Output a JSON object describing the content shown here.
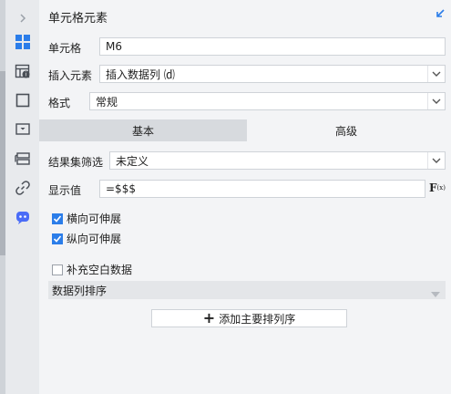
{
  "panel": {
    "title": "单元格元素"
  },
  "sidebar": {
    "items": [
      {
        "icon": "chevron-right-icon"
      },
      {
        "icon": "cell-element-icon",
        "active": true
      },
      {
        "icon": "cell-properties-icon"
      },
      {
        "icon": "cell-border-icon"
      },
      {
        "icon": "widget-icon"
      },
      {
        "icon": "condition-icon"
      },
      {
        "icon": "hyperlink-icon"
      },
      {
        "icon": "chat-bot-icon"
      }
    ]
  },
  "fields": {
    "cell_label": "单元格",
    "cell_value": "M6",
    "insert_label": "插入元素",
    "insert_value": "插入数据列 ⒟",
    "format_label": "格式",
    "format_value": "常规"
  },
  "tabs": {
    "basic": "基本",
    "advanced": "高级"
  },
  "basic": {
    "filter_label": "结果集筛选",
    "filter_value": "未定义",
    "display_label": "显示值",
    "display_value": "=$$$",
    "fx_label": "F",
    "fx_sub": "(x)",
    "expand_h_label": "横向可伸展",
    "expand_h_checked": true,
    "expand_v_label": "纵向可伸展",
    "expand_v_checked": true,
    "fill_blank_label": "补充空白数据",
    "fill_blank_checked": false,
    "sort_label": "数据列排序",
    "add_sort_label": "添加主要排列序"
  },
  "colors": {
    "accent": "#2b7de9",
    "panel_bg": "#f3f4f6",
    "sidebar_bg": "#e8eaed"
  }
}
